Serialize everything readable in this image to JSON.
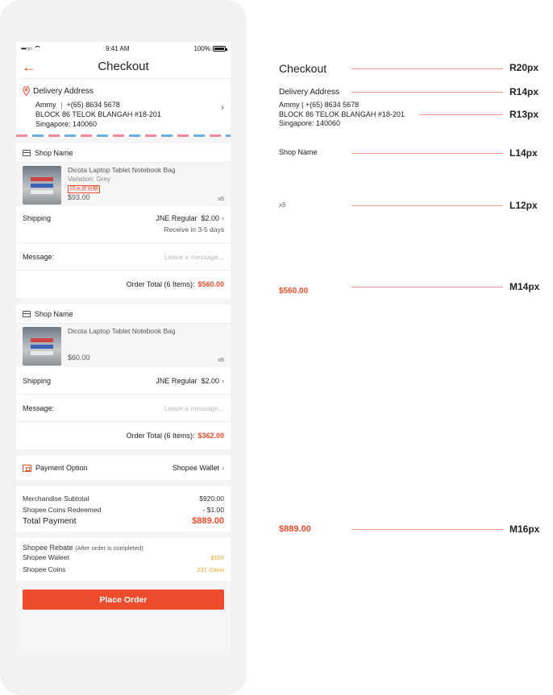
{
  "status_bar": {
    "carrier": "•••○○",
    "time": "9:41 AM",
    "battery": "100%",
    "battery_level": 1.0
  },
  "header": {
    "title": "Checkout",
    "back_icon": "arrow-left-icon"
  },
  "address": {
    "label": "Delivery Address",
    "name": "Ammy",
    "phone": "+(65) 8634 5678",
    "line1": "BLOCK 86 TELOK BLANGAH #18-201",
    "line2": "Singapore: 140060"
  },
  "shops": [
    {
      "shop_name": "Shop Name",
      "product_name": "Dicota Laptop Tablet Notebook Bag",
      "variation": "Variation: Grey",
      "tag": "15天退货期",
      "price": "$93.00",
      "qty": "x6",
      "shipping_label": "Shipping",
      "shipping_method": "JNE Regular",
      "shipping_price": "$2.00",
      "shipping_eta": "Receive in 3-5 days",
      "message_label": "Message:",
      "message_placeholder": "Leave a message...",
      "order_total_label": "Order Total (6 Items):",
      "order_total": "$560.00"
    },
    {
      "shop_name": "Shop Name",
      "product_name": "Dicota Laptop Tablet Notebook Bag",
      "price": "$60.00",
      "qty": "x6",
      "shipping_label": "Shipping",
      "shipping_method": "JNE Regular",
      "shipping_price": "$2.00",
      "message_label": "Message:",
      "message_placeholder": "Leave a message...",
      "order_total_label": "Order Total (6 Items):",
      "order_total": "$362.00"
    }
  ],
  "payment": {
    "label": "Payment Option",
    "value": "Shopee Wallet"
  },
  "summary": {
    "subtotal_label": "Merchandise Subtotal",
    "subtotal": "$920.00",
    "coins_label": "Shopee Coins Redeemed",
    "coins": "- $1.00",
    "total_label": "Total Payment",
    "total": "$889.00"
  },
  "rebate": {
    "title": "Shopee Rebate",
    "note": "(After order is completed)",
    "wallet_label": "Shopee Waleet",
    "wallet_value": "$100",
    "coins_label": "Shopee Coins",
    "coins_value": "237 Coins"
  },
  "place_order": "Place Order",
  "annotations": [
    {
      "sample": "Checkout",
      "spec": "R20px"
    },
    {
      "sample": "Delivery Address",
      "spec": "R14px"
    },
    {
      "sample": "Ammy  |  +(65) 8634 5678",
      "sample2": "BLOCK 86 TELOK BLANGAH #18-201",
      "sample3": "Singapore: 140060",
      "spec": "R13px"
    },
    {
      "sample": "Shop Name",
      "spec": "L14px"
    },
    {
      "sample": "x6",
      "spec": "L12px"
    },
    {
      "sample": "$560.00",
      "spec": "M14px"
    },
    {
      "sample": "$889.00",
      "spec": "M16px"
    }
  ],
  "colors": {
    "accent": "#ee4d2d",
    "rebate": "#f5a623",
    "stripe_pink": "#f38aa0",
    "stripe_blue": "#6aaee0"
  }
}
